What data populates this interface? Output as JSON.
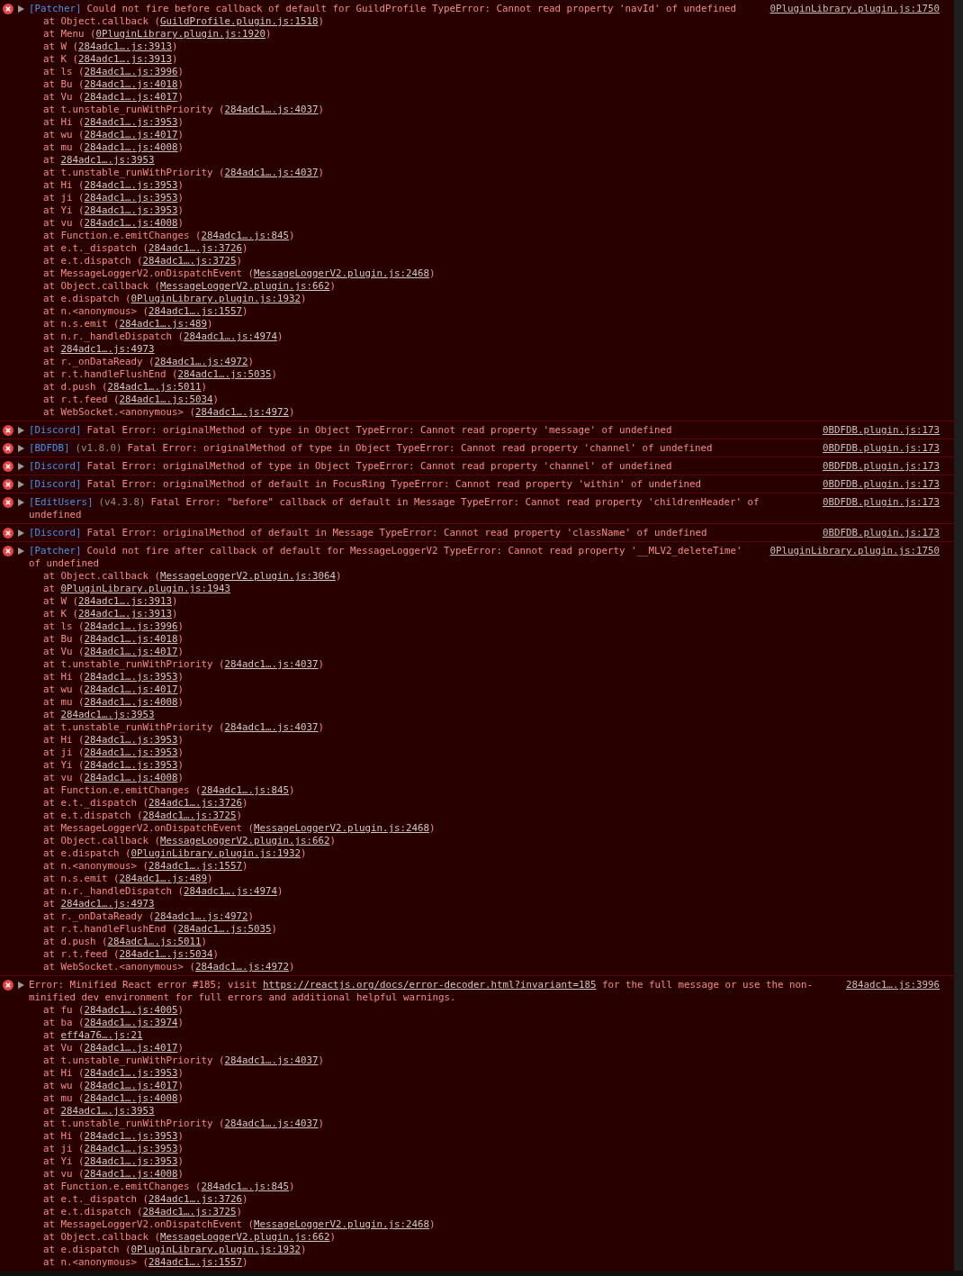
{
  "console": {
    "messages": [
      {
        "tag": "[Patcher]",
        "text": "Could not fire before callback of default for GuildProfile TypeError: Cannot read property 'navId' of undefined",
        "source": "0PluginLibrary.plugin.js:1750",
        "frames": [
          {
            "before": "at Object.callback (",
            "link": "GuildProfile.plugin.js:1518",
            "after": ")"
          },
          {
            "before": "at Menu (",
            "link": "0PluginLibrary.plugin.js:1920",
            "after": ")"
          },
          {
            "before": "at W (",
            "link": "284adc1….js:3913",
            "after": ")"
          },
          {
            "before": "at K (",
            "link": "284adc1….js:3913",
            "after": ")"
          },
          {
            "before": "at ls (",
            "link": "284adc1….js:3996",
            "after": ")"
          },
          {
            "before": "at Bu (",
            "link": "284adc1….js:4018",
            "after": ")"
          },
          {
            "before": "at Vu (",
            "link": "284adc1….js:4017",
            "after": ")"
          },
          {
            "before": "at t.unstable_runWithPriority (",
            "link": "284adc1….js:4037",
            "after": ")"
          },
          {
            "before": "at Hi (",
            "link": "284adc1….js:3953",
            "after": ")"
          },
          {
            "before": "at wu (",
            "link": "284adc1….js:4017",
            "after": ")"
          },
          {
            "before": "at mu (",
            "link": "284adc1….js:4008",
            "after": ")"
          },
          {
            "before": "at ",
            "link": "284adc1….js:3953"
          },
          {
            "before": "at t.unstable_runWithPriority (",
            "link": "284adc1….js:4037",
            "after": ")"
          },
          {
            "before": "at Hi (",
            "link": "284adc1….js:3953",
            "after": ")"
          },
          {
            "before": "at ji (",
            "link": "284adc1….js:3953",
            "after": ")"
          },
          {
            "before": "at Yi (",
            "link": "284adc1….js:3953",
            "after": ")"
          },
          {
            "before": "at vu (",
            "link": "284adc1….js:4008",
            "after": ")"
          },
          {
            "before": "at Function.e.emitChanges (",
            "link": "284adc1….js:845",
            "after": ")"
          },
          {
            "before": "at e.t._dispatch (",
            "link": "284adc1….js:3726",
            "after": ")"
          },
          {
            "before": "at e.t.dispatch (",
            "link": "284adc1….js:3725",
            "after": ")"
          },
          {
            "before": "at MessageLoggerV2.onDispatchEvent (",
            "link": "MessageLoggerV2.plugin.js:2468",
            "after": ")"
          },
          {
            "before": "at Object.callback (",
            "link": "MessageLoggerV2.plugin.js:662",
            "after": ")"
          },
          {
            "before": "at e.dispatch (",
            "link": "0PluginLibrary.plugin.js:1932",
            "after": ")"
          },
          {
            "before": "at n.<anonymous> (",
            "link": "284adc1….js:1557",
            "after": ")"
          },
          {
            "before": "at n.s.emit (",
            "link": "284adc1….js:489",
            "after": ")"
          },
          {
            "before": "at n.r._handleDispatch (",
            "link": "284adc1….js:4974",
            "after": ")"
          },
          {
            "before": "at ",
            "link": "284adc1….js:4973"
          },
          {
            "before": "at r._onDataReady (",
            "link": "284adc1….js:4972",
            "after": ")"
          },
          {
            "before": "at r.t.handleFlushEnd (",
            "link": "284adc1….js:5035",
            "after": ")"
          },
          {
            "before": "at d.push (",
            "link": "284adc1….js:5011",
            "after": ")"
          },
          {
            "before": "at r.t.feed (",
            "link": "284adc1….js:5034",
            "after": ")"
          },
          {
            "before": "at WebSocket.<anonymous> (",
            "link": "284adc1….js:4972",
            "after": ")"
          }
        ]
      },
      {
        "tag": "[Discord]",
        "text": "Fatal Error: originalMethod of type in Object TypeError: Cannot read property 'message' of undefined",
        "source": "0BDFDB.plugin.js:173"
      },
      {
        "tag": "[BDFDB]",
        "version": "(v1.8.0)",
        "text": "Fatal Error: originalMethod of type in Object TypeError: Cannot read property 'channel' of undefined",
        "source": "0BDFDB.plugin.js:173"
      },
      {
        "tag": "[Discord]",
        "text": "Fatal Error: originalMethod of type in Object TypeError: Cannot read property 'channel' of undefined",
        "source": "0BDFDB.plugin.js:173"
      },
      {
        "tag": "[Discord]",
        "text": "Fatal Error: originalMethod of default in FocusRing TypeError: Cannot read property 'within' of undefined",
        "source": "0BDFDB.plugin.js:173"
      },
      {
        "tag": "[EditUsers]",
        "version": "(v4.3.8)",
        "text": "Fatal Error: \"before\" callback of default in Message TypeError: Cannot read property 'childrenHeader' of undefined",
        "source": "0BDFDB.plugin.js:173"
      },
      {
        "tag": "[Discord]",
        "text": "Fatal Error: originalMethod of default in Message TypeError: Cannot read property 'className' of undefined",
        "source": "0BDFDB.plugin.js:173"
      },
      {
        "tag": "[Patcher]",
        "text": "Could not fire after callback of default for MessageLoggerV2 TypeError: Cannot read property '__MLV2_deleteTime' of undefined",
        "source": "0PluginLibrary.plugin.js:1750",
        "frames": [
          {
            "before": "at Object.callback (",
            "link": "MessageLoggerV2.plugin.js:3064",
            "after": ")"
          },
          {
            "before": "at ",
            "link": "0PluginLibrary.plugin.js:1943"
          },
          {
            "before": "at W (",
            "link": "284adc1….js:3913",
            "after": ")"
          },
          {
            "before": "at K (",
            "link": "284adc1….js:3913",
            "after": ")"
          },
          {
            "before": "at ls (",
            "link": "284adc1….js:3996",
            "after": ")"
          },
          {
            "before": "at Bu (",
            "link": "284adc1….js:4018",
            "after": ")"
          },
          {
            "before": "at Vu (",
            "link": "284adc1….js:4017",
            "after": ")"
          },
          {
            "before": "at t.unstable_runWithPriority (",
            "link": "284adc1….js:4037",
            "after": ")"
          },
          {
            "before": "at Hi (",
            "link": "284adc1….js:3953",
            "after": ")"
          },
          {
            "before": "at wu (",
            "link": "284adc1….js:4017",
            "after": ")"
          },
          {
            "before": "at mu (",
            "link": "284adc1….js:4008",
            "after": ")"
          },
          {
            "before": "at ",
            "link": "284adc1….js:3953"
          },
          {
            "before": "at t.unstable_runWithPriority (",
            "link": "284adc1….js:4037",
            "after": ")"
          },
          {
            "before": "at Hi (",
            "link": "284adc1….js:3953",
            "after": ")"
          },
          {
            "before": "at ji (",
            "link": "284adc1….js:3953",
            "after": ")"
          },
          {
            "before": "at Yi (",
            "link": "284adc1….js:3953",
            "after": ")"
          },
          {
            "before": "at vu (",
            "link": "284adc1….js:4008",
            "after": ")"
          },
          {
            "before": "at Function.e.emitChanges (",
            "link": "284adc1….js:845",
            "after": ")"
          },
          {
            "before": "at e.t._dispatch (",
            "link": "284adc1….js:3726",
            "after": ")"
          },
          {
            "before": "at e.t.dispatch (",
            "link": "284adc1….js:3725",
            "after": ")"
          },
          {
            "before": "at MessageLoggerV2.onDispatchEvent (",
            "link": "MessageLoggerV2.plugin.js:2468",
            "after": ")"
          },
          {
            "before": "at Object.callback (",
            "link": "MessageLoggerV2.plugin.js:662",
            "after": ")"
          },
          {
            "before": "at e.dispatch (",
            "link": "0PluginLibrary.plugin.js:1932",
            "after": ")"
          },
          {
            "before": "at n.<anonymous> (",
            "link": "284adc1….js:1557",
            "after": ")"
          },
          {
            "before": "at n.s.emit (",
            "link": "284adc1….js:489",
            "after": ")"
          },
          {
            "before": "at n.r._handleDispatch (",
            "link": "284adc1….js:4974",
            "after": ")"
          },
          {
            "before": "at ",
            "link": "284adc1….js:4973"
          },
          {
            "before": "at r._onDataReady (",
            "link": "284adc1….js:4972",
            "after": ")"
          },
          {
            "before": "at r.t.handleFlushEnd (",
            "link": "284adc1….js:5035",
            "after": ")"
          },
          {
            "before": "at d.push (",
            "link": "284adc1….js:5011",
            "after": ")"
          },
          {
            "before": "at r.t.feed (",
            "link": "284adc1….js:5034",
            "after": ")"
          },
          {
            "before": "at WebSocket.<anonymous> (",
            "link": "284adc1….js:4972",
            "after": ")"
          }
        ]
      },
      {
        "text": "Error: Minified React error #185; visit",
        "url": "https://reactjs.org/docs/error-decoder.html?invariant=185",
        "text_after": "for the full message or use the non-minified dev environment for full errors and additional helpful warnings.",
        "source": "284adc1….js:3996",
        "frames": [
          {
            "before": "at fu (",
            "link": "284adc1….js:4005",
            "after": ")"
          },
          {
            "before": "at ba (",
            "link": "284adc1….js:3974",
            "after": ")"
          },
          {
            "before": "at ",
            "link": "eff4a76….js:21"
          },
          {
            "before": "at Vu (",
            "link": "284adc1….js:4017",
            "after": ")"
          },
          {
            "before": "at t.unstable_runWithPriority (",
            "link": "284adc1….js:4037",
            "after": ")"
          },
          {
            "before": "at Hi (",
            "link": "284adc1….js:3953",
            "after": ")"
          },
          {
            "before": "at wu (",
            "link": "284adc1….js:4017",
            "after": ")"
          },
          {
            "before": "at mu (",
            "link": "284adc1….js:4008",
            "after": ")"
          },
          {
            "before": "at ",
            "link": "284adc1….js:3953"
          },
          {
            "before": "at t.unstable_runWithPriority (",
            "link": "284adc1….js:4037",
            "after": ")"
          },
          {
            "before": "at Hi (",
            "link": "284adc1….js:3953",
            "after": ")"
          },
          {
            "before": "at ji (",
            "link": "284adc1….js:3953",
            "after": ")"
          },
          {
            "before": "at Yi (",
            "link": "284adc1….js:3953",
            "after": ")"
          },
          {
            "before": "at vu (",
            "link": "284adc1….js:4008",
            "after": ")"
          },
          {
            "before": "at Function.e.emitChanges (",
            "link": "284adc1….js:845",
            "after": ")"
          },
          {
            "before": "at e.t._dispatch (",
            "link": "284adc1….js:3726",
            "after": ")"
          },
          {
            "before": "at e.t.dispatch (",
            "link": "284adc1….js:3725",
            "after": ")"
          },
          {
            "before": "at MessageLoggerV2.onDispatchEvent (",
            "link": "MessageLoggerV2.plugin.js:2468",
            "after": ")"
          },
          {
            "before": "at Object.callback (",
            "link": "MessageLoggerV2.plugin.js:662",
            "after": ")"
          },
          {
            "before": "at e.dispatch (",
            "link": "0PluginLibrary.plugin.js:1932",
            "after": ")"
          },
          {
            "before": "at n.<anonymous> (",
            "link": "284adc1….js:1557",
            "after": ")"
          }
        ]
      }
    ]
  }
}
